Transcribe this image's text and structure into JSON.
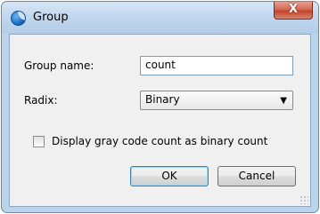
{
  "window": {
    "title": "Group",
    "close_glyph": "X"
  },
  "form": {
    "group_name_label": "Group name:",
    "group_name_value": "count",
    "radix_label": "Radix:",
    "radix_selected": "Binary",
    "dropdown_arrow": "▼",
    "checkbox_label": "Display gray code count as binary count",
    "checkbox_checked": false
  },
  "buttons": {
    "ok": "OK",
    "cancel": "Cancel"
  },
  "icons": {
    "app": "app-globe-icon",
    "close": "close-icon",
    "dropdown": "chevron-down-icon",
    "resize": "resize-grip-icon"
  }
}
